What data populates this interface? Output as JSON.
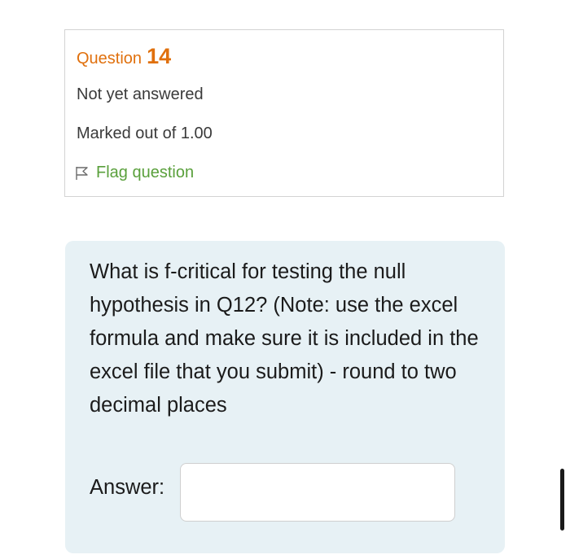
{
  "question_info": {
    "label": "Question",
    "number": "14",
    "status": "Not yet answered",
    "marks": "Marked out of 1.00",
    "flag_label": "Flag question"
  },
  "question": {
    "text": "What is f-critical for testing the null hypothesis in Q12? (Note: use the excel formula and make sure it is included in the excel file that you submit) - round to two decimal places",
    "answer_label": "Answer:",
    "answer_value": ""
  },
  "colors": {
    "header": "#e0700d",
    "flag_link": "#5aa03c",
    "question_bg": "#e7f1f5",
    "text": "#1b1b1b"
  },
  "icons": {
    "flag": "flag-icon"
  }
}
